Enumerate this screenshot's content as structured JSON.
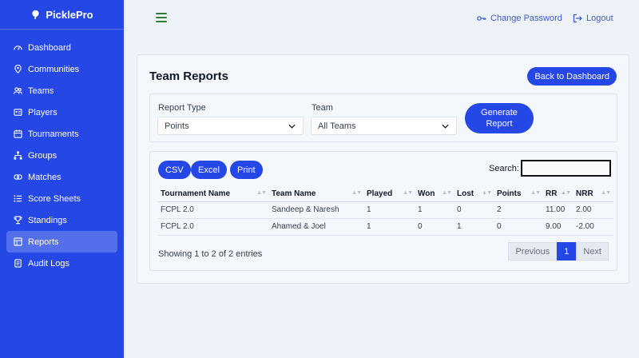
{
  "brand": {
    "name": "PicklePro"
  },
  "sidebar": {
    "items": [
      {
        "label": "Dashboard",
        "icon": "dashboard-icon"
      },
      {
        "label": "Communities",
        "icon": "map-pin-icon"
      },
      {
        "label": "Teams",
        "icon": "users-icon"
      },
      {
        "label": "Players",
        "icon": "id-card-icon"
      },
      {
        "label": "Tournaments",
        "icon": "calendar-icon"
      },
      {
        "label": "Groups",
        "icon": "hierarchy-icon"
      },
      {
        "label": "Matches",
        "icon": "matches-icon"
      },
      {
        "label": "Score Sheets",
        "icon": "list-icon"
      },
      {
        "label": "Standings",
        "icon": "trophy-icon"
      },
      {
        "label": "Reports",
        "icon": "report-icon",
        "active": true
      },
      {
        "label": "Audit Logs",
        "icon": "log-icon"
      }
    ]
  },
  "header": {
    "change_password": "Change Password",
    "logout": "Logout"
  },
  "page": {
    "title": "Team Reports",
    "back_button": "Back to Dashboard"
  },
  "filters": {
    "report_type_label": "Report Type",
    "report_type_value": "Points",
    "team_label": "Team",
    "team_value": "All Teams",
    "generate_line1": "Generate",
    "generate_line2": "Report"
  },
  "export": {
    "csv": "CSV",
    "excel": "Excel",
    "print": "Print"
  },
  "search": {
    "label": "Search:",
    "value": ""
  },
  "table": {
    "columns": [
      "Tournament Name",
      "Team Name",
      "Played",
      "Won",
      "Lost",
      "Points",
      "RR",
      "NRR"
    ],
    "rows": [
      [
        "FCPL 2.0",
        "Sandeep & Naresh",
        "1",
        "1",
        "0",
        "2",
        "11.00",
        "2.00"
      ],
      [
        "FCPL 2.0",
        "Ahamed & Joel",
        "1",
        "0",
        "1",
        "0",
        "9.00",
        "-2.00"
      ]
    ]
  },
  "footer": {
    "showing": "Showing 1 to 2 of 2 entries",
    "previous": "Previous",
    "current_page": "1",
    "next": "Next"
  },
  "colors": {
    "primary": "#2447e6",
    "background": "#eef2f9",
    "menu_icon": "#2e7d32"
  }
}
